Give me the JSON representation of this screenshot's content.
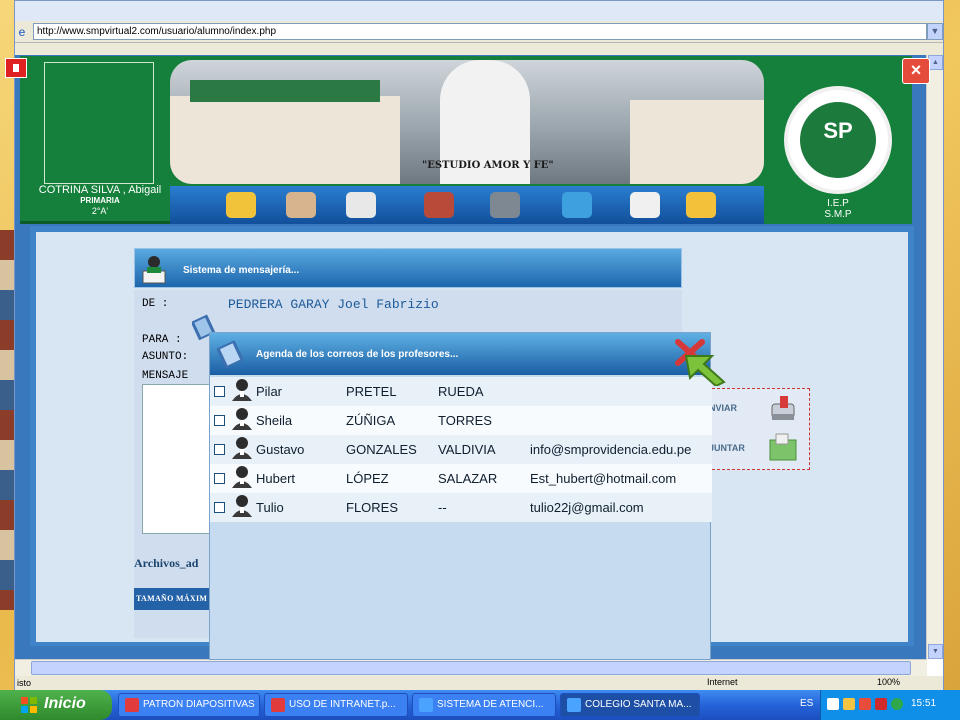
{
  "browser": {
    "address": "http://www.smpvirtual2.com/usuario/alumno/index.php",
    "status_text": "isto",
    "status_zone": "Internet",
    "status_zoom": "100%"
  },
  "student": {
    "name": "COTRINA SILVA , Abigail",
    "level": "PRIMARIA",
    "section": "2°A'"
  },
  "school": {
    "motto": "\"ESTUDIO AMOR Y FE\"",
    "initials": "SP",
    "name_line1": "I.E.P",
    "name_line2": "S.M.P"
  },
  "messaging": {
    "title": "Sistema de mensajería...",
    "from_label": "DE :",
    "from_value": "PEDRERA GARAY Joel Fabrizio",
    "to_label": "PARA :",
    "subject_label": "ASUNTO:",
    "message_label": "MENSAJE",
    "attachments_label": "Archivos_ad",
    "max_size_label": "TAMAÑO MÁXIM",
    "send_label": "NVIAR",
    "attach_label": "JUNTAR"
  },
  "agenda": {
    "title": "Agenda de los correos de los profesores...",
    "teachers": [
      {
        "first": "Pilar",
        "last1": "PRETEL",
        "last2": "RUEDA",
        "email": ""
      },
      {
        "first": "Sheila",
        "last1": "ZÚÑIGA",
        "last2": "TORRES",
        "email": ""
      },
      {
        "first": "Gustavo",
        "last1": "GONZALES",
        "last2": "VALDIVIA",
        "email": "info@smprovidencia.edu.pe"
      },
      {
        "first": "Hubert",
        "last1": "LÓPEZ",
        "last2": "SALAZAR",
        "email": "Est_hubert@hotmail.com"
      },
      {
        "first": "Tulio",
        "last1": "FLORES",
        "last2": "--",
        "email": "tulio22j@gmail.com"
      }
    ]
  },
  "taskbar": {
    "start": "Inicio",
    "tasks": [
      "PATRON DIAPOSITIVAS",
      "USO DE INTRANET.p...",
      "SISTEMA DE ATENCI...",
      "COLEGIO SANTA MA..."
    ],
    "lang": "ES",
    "clock": "15:51"
  },
  "colors": {
    "school_green": "#15803b",
    "header_blue": "#1d66ad",
    "taskbar_blue": "#2563d8"
  }
}
